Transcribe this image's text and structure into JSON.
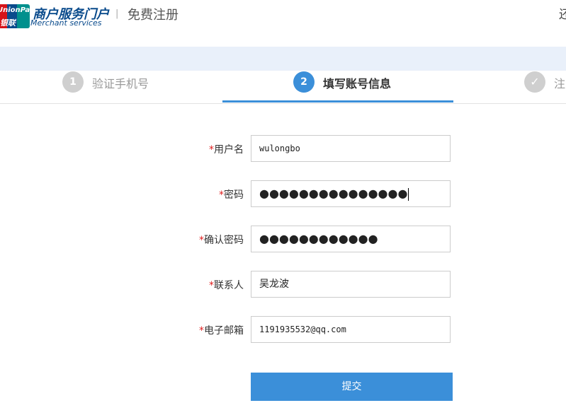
{
  "header": {
    "logo_text_top": "UnionPay",
    "logo_text_bottom": "银联",
    "brand_cn": "商户服务门户",
    "brand_en": "Merchant services",
    "separator": "|",
    "page_title": "免费注册",
    "right_text": "还"
  },
  "steps": [
    {
      "number": "1",
      "label": "验证手机号",
      "state": "inactive"
    },
    {
      "number": "2",
      "label": "填写账号信息",
      "state": "active"
    },
    {
      "number": "✓",
      "label": "注",
      "state": "inactive"
    }
  ],
  "form": {
    "required_mark": "*",
    "fields": [
      {
        "label": "用户名",
        "value": "wulongbo",
        "type": "text"
      },
      {
        "label": "密码",
        "value": "●●●●●●●●●●●●●●●",
        "type": "password"
      },
      {
        "label": "确认密码",
        "value": "●●●●●●●●●●●●",
        "type": "password"
      },
      {
        "label": "联系人",
        "value": "吴龙波",
        "type": "text"
      },
      {
        "label": "电子邮箱",
        "value": "1191935532@qq.com",
        "type": "text"
      }
    ],
    "submit_label": "提交"
  },
  "colors": {
    "accent": "#3b8fd9",
    "band": "#e9f0fa",
    "required": "#e02020",
    "inactive_step": "#cfcfcf"
  }
}
